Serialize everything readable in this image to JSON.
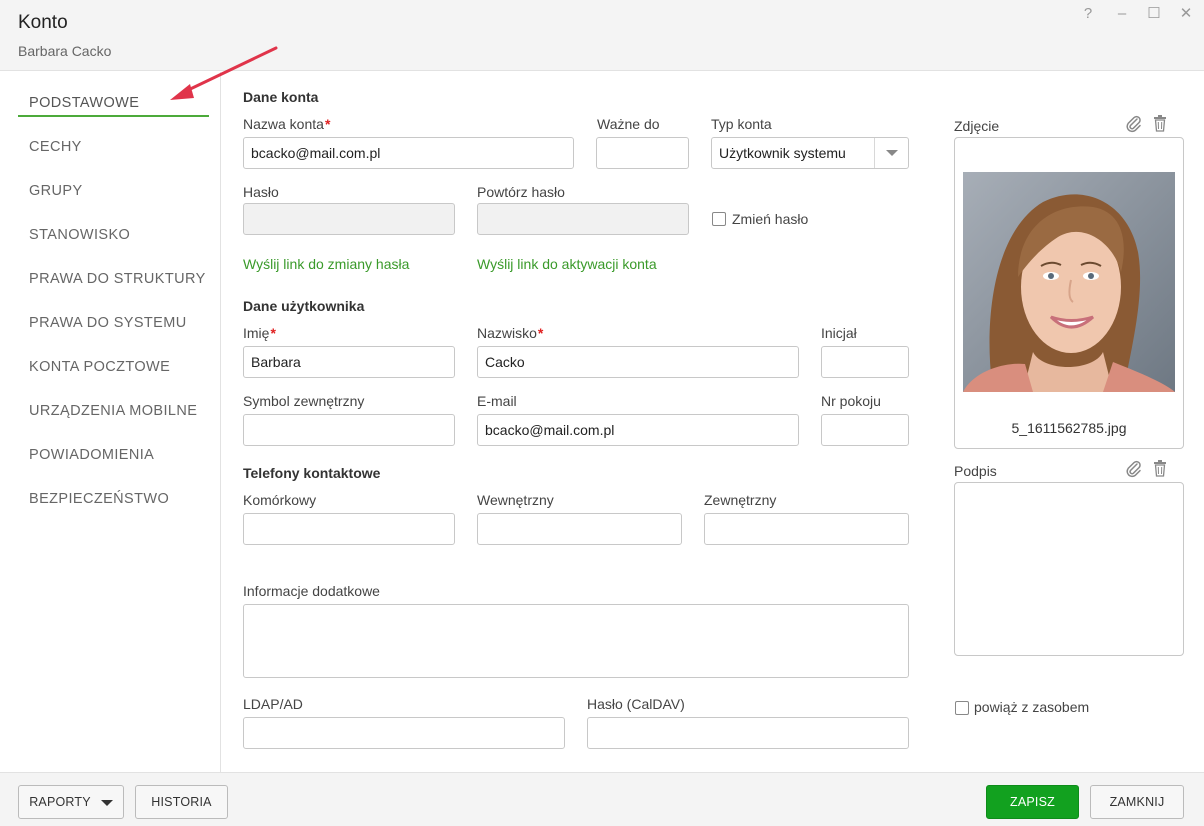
{
  "window": {
    "title": "Konto",
    "subtitle": "Barbara Cacko",
    "help_glyph": "?",
    "minimize_glyph": "–",
    "maximize_glyph": "☐",
    "close_glyph": "✕"
  },
  "sidebar": {
    "items": [
      {
        "label": "PODSTAWOWE"
      },
      {
        "label": "CECHY"
      },
      {
        "label": "GRUPY"
      },
      {
        "label": "STANOWISKO"
      },
      {
        "label": "PRAWA DO STRUKTURY"
      },
      {
        "label": "PRAWA DO SYSTEMU"
      },
      {
        "label": "KONTA POCZTOWE"
      },
      {
        "label": "URZĄDZENIA MOBILNE"
      },
      {
        "label": "POWIADOMIENIA"
      },
      {
        "label": "BEZPIECZEŃSTWO"
      }
    ],
    "active_index": 0
  },
  "account": {
    "section_title": "Dane konta",
    "name_label": "Nazwa konta",
    "name_value": "bcacko@mail.com.pl",
    "valid_to_label": "Ważne do",
    "valid_to_value": "",
    "type_label": "Typ konta",
    "type_value": "Użytkownik systemu",
    "password_label": "Hasło",
    "repeat_password_label": "Powtórz hasło",
    "change_password_label": "Zmień hasło",
    "send_reset_link": "Wyślij link do zmiany hasła",
    "send_activation_link": "Wyślij link do aktywacji konta"
  },
  "user": {
    "section_title": "Dane użytkownika",
    "first_name_label": "Imię",
    "first_name_value": "Barbara",
    "last_name_label": "Nazwisko",
    "last_name_value": "Cacko",
    "initial_label": "Inicjał",
    "initial_value": "",
    "external_symbol_label": "Symbol zewnętrzny",
    "external_symbol_value": "",
    "email_label": "E-mail",
    "email_value": "bcacko@mail.com.pl",
    "room_label": "Nr pokoju",
    "room_value": ""
  },
  "phones": {
    "section_title": "Telefony kontaktowe",
    "mobile_label": "Komórkowy",
    "internal_label": "Wewnętrzny",
    "external_label": "Zewnętrzny"
  },
  "extra": {
    "info_label": "Informacje dodatkowe",
    "ldap_label": "LDAP/AD",
    "caldav_label": "Hasło (CalDAV)"
  },
  "right_panel": {
    "photo_label": "Zdjęcie",
    "photo_filename": "5_1611562785.jpg",
    "signature_label": "Podpis",
    "link_resource_label": "powiąż z zasobem"
  },
  "footer": {
    "reports_label": "RAPORTY",
    "history_label": "HISTORIA",
    "save_label": "ZAPISZ",
    "close_label": "ZAMKNIJ"
  },
  "colors": {
    "accent_green": "#12a11f",
    "link_green": "#3a9a2a",
    "required_red": "#e02020",
    "arrow_red": "#e0344a"
  }
}
